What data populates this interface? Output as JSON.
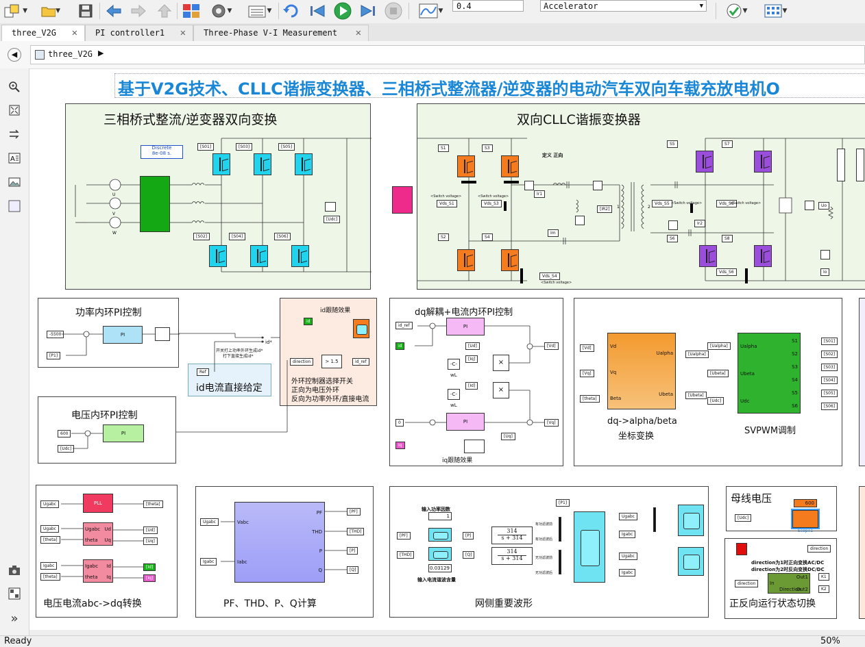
{
  "toolbar": {
    "stop_time": "0.4",
    "sim_mode": "Accelerator",
    "icons": [
      "new-model-icon",
      "open-folder-icon",
      "save-icon",
      "back-arrow-icon",
      "forward-arrow-icon",
      "up-arrow-icon",
      "library-browser-icon",
      "model-config-icon",
      "explorer-icon",
      "update-icon",
      "step-back-icon",
      "run-icon",
      "step-forward-icon",
      "stop-icon",
      "data-inspector-icon",
      "check-icon",
      "grid-icon"
    ]
  },
  "tabs": [
    {
      "label": "three_V2G"
    },
    {
      "label": "PI controller1"
    },
    {
      "label": "Three-Phase V-I Measurement"
    }
  ],
  "breadcrumb": {
    "label": "three_V2G"
  },
  "canvas": {
    "banner": "基于V2G技术、CLLC谐振变换器、三相桥式整流器/逆变器的电动汽车双向车载充放电机O",
    "rectifier_title": "三相桥式整流/逆变器双向变换",
    "cllc_title": "双向CLLC谐振变换器",
    "powergui": [
      "Discrete",
      "8e-08 s."
    ],
    "cllc_note": "定义 正向",
    "power_loop_title": "功率内环PI控制",
    "voltage_loop_title": "电压内环PI控制",
    "id_direct_title": "id电流直接给定",
    "id_tracking": "id跟随效果",
    "switch_notes": [
      "外环控制器选择开关",
      "正向为电压外环",
      "反向为功率外环/直接电流"
    ],
    "switch_small": [
      "开关打上功率外环生成id*",
      "打下直接生成id*"
    ],
    "dq_title": "dq解耦+电流内环PI控制",
    "iq_tracking": "iq跟随效果",
    "ipark_title": [
      "dq->alpha/beta",
      "坐标变换"
    ],
    "svpwm_title": "SVPWM调制",
    "abc_dq_title": "电压电流abc->dq转换",
    "pf_title": "PF、THD、P、Q计算",
    "grid_wave_title": "网侧重要波形",
    "bus_title": "母线电压",
    "mode_title": "正反向运行状态切换",
    "mode_notes": [
      "direction为1时正向变换AC/DC",
      "direction为2时反向变换DC/DC"
    ],
    "labels": {
      "s01": "[S01]",
      "s02": "[S02]",
      "s03": "[S03]",
      "s04": "[S04]",
      "s05": "[S05]",
      "s06": "[S06]",
      "udc": "[Udc]",
      "s1": "S1",
      "s2": "S2",
      "s3": "S3",
      "s4": "S4",
      "s5": "S5",
      "s6": "S6",
      "s7": "S7",
      "s8": "S8",
      "ir1": "Ir1",
      "ir2": "Ir2",
      "irr2": "[IR2]",
      "im": "Im",
      "uo": "Uo",
      "io": "Io",
      "vds_s1": "Vds_S1",
      "vds_s3": "Vds_S3",
      "vds_s4": "Vds_S4",
      "vds_s5": "Vds_S5",
      "vds_s6": "Vds_S6",
      "vds_s8": "Vds_S8",
      "switch_voltage": "<Switch voltage>",
      "m5500": "-5500",
      "p1": "[P1]",
      "pi": "PI",
      "ref": "Ref",
      "id_star": "id*",
      "direction": "direction",
      "gt15": "> 1.5",
      "id_ref": "id_ref",
      "id": "id",
      "v600": "600",
      "udc2": "[Udc]",
      "idref2": "id_ref",
      "id2": "id",
      "iq_ref": "0",
      "iq": "Iq",
      "vd": "[Vd]",
      "vq": "[Vq]",
      "ud": "[Ud]",
      "uq": "[Uq]",
      "iq2": "[Iq]",
      "id3": "[Id]",
      "minus_c": "-C-",
      "wl": "wL",
      "times": "×",
      "ipark_vd": "[Vd]",
      "ipark_vq": "[Vq]",
      "ipark_theta": "[theta]",
      "ualpha": "[Ualpha]",
      "ubeta": "[Ubeta]",
      "pin_vd": "Vd",
      "pin_vq": "Vq",
      "pin_beta": "Beta",
      "pin_ualpha": "Ualpha",
      "pin_ubeta": "Ubeta",
      "sv_ualpha": "[Ualpha]",
      "sv_ubeta": "[Ubeta]",
      "sv_udc": "[Udc]",
      "pin_ua": "Ualpha",
      "pin_ub": "Ubeta",
      "pin_udc": "Udc",
      "so1": "[S01]",
      "so2": "[S02]",
      "so3": "[S03]",
      "so4": "[S04]",
      "so5": "[S05]",
      "so6": "[S06]",
      "p_s1": "S1",
      "p_s2": "S2",
      "p_s3": "S3",
      "p_s4": "S4",
      "p_s5": "S5",
      "p_s6": "S6",
      "ugabc": "Ugabc",
      "igabc": "Igabc",
      "theta": "[theta]",
      "pll": "PLL",
      "ud2": "[Ud]",
      "uq2": "[Uq]",
      "id4": "[Id]",
      "iq3": "[Iq]",
      "pin_ugabc": "Ugabc",
      "pin_theta": "theta",
      "pin_ud": "Ud",
      "pin_uq": "Uq",
      "pin_igabc": "Igabc",
      "pin_id": "Id",
      "pin_iq": "Iq",
      "pf": "[PF]",
      "thd": "[THD]",
      "p": "[P]",
      "q": "[Q]",
      "pin_vabc": "Vabc",
      "pin_iabc": "Iabc",
      "pin_pf": "PF",
      "pin_thd": "THD",
      "pin_p": "P",
      "pin_q": "Q",
      "pf_in": "[PF]",
      "thd_in": "[THD]",
      "p_in": "[P]",
      "q_in": "[Q]",
      "p1_out": "[P1]",
      "display1_label": "输入功率因数",
      "display1_val": "1",
      "display2_label": "输入电流谐波含量",
      "display2_val": "0.03129",
      "tf_num": "314",
      "tf_den": "s + 314",
      "filt1": "有功滤波前",
      "filt2": "有功滤波后",
      "filt3": "无功滤波前",
      "filt4": "无功滤波后",
      "bus_udc": "[Udc]",
      "bus_val": "600",
      "scope1": "Scope1",
      "dir_out": "direction",
      "dir_in": "direction",
      "k1": "K1",
      "k2": "K2",
      "pin_in": "In",
      "pin_out1": "Out1",
      "pin_out2": "Out2",
      "dir_block": "Direction"
    }
  },
  "status": {
    "left": "Ready",
    "zoom": "50%"
  },
  "colors": {
    "banner": "#1a87d6",
    "igbt_cyan": "#22d3ee",
    "igbt_orange": "#f47c1e",
    "igbt_purple": "#9b4ddb",
    "pink": "#ee2a8a",
    "green_block": "#19b319",
    "violet": "#9e9ef7",
    "tf_orange": "#f39a2f"
  }
}
